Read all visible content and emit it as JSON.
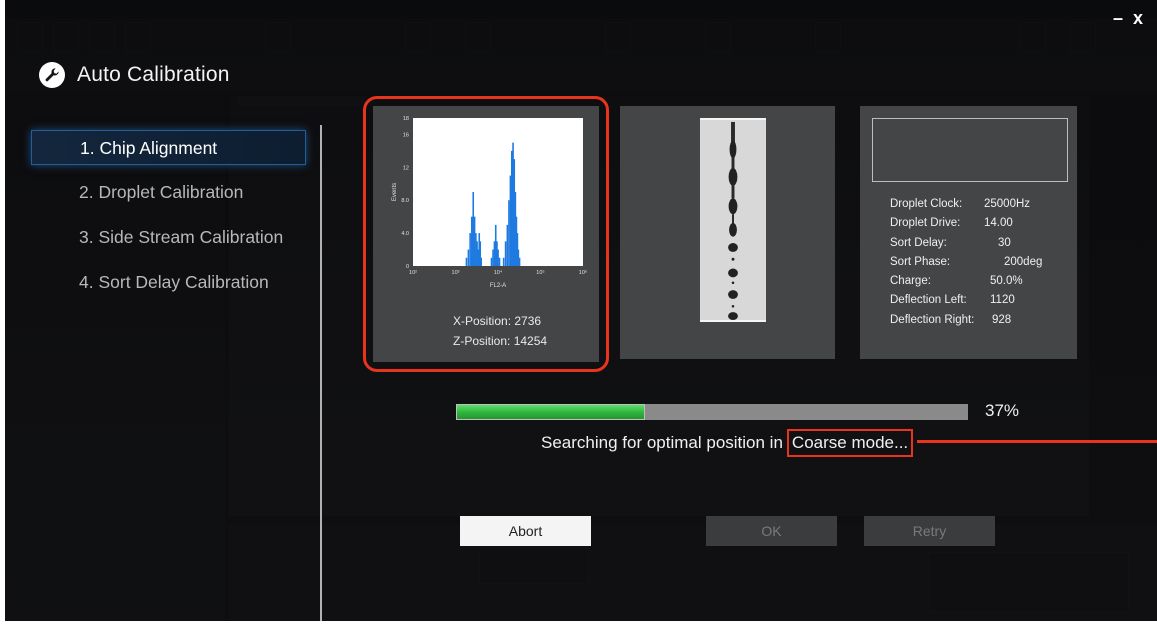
{
  "window": {
    "minimize_label": "–",
    "close_label": "x"
  },
  "dialog": {
    "title": "Auto Calibration"
  },
  "steps": [
    {
      "label": "1. Chip Alignment",
      "active": true
    },
    {
      "label": "2. Droplet Calibration",
      "active": false
    },
    {
      "label": "3. Side Stream Calibration",
      "active": false
    },
    {
      "label": "4. Sort Delay Calibration",
      "active": false
    }
  ],
  "chip_panel": {
    "x_position_label": "X-Position:",
    "x_position_value": "2736",
    "z_position_label": "Z-Position:",
    "z_position_value": "14254"
  },
  "chart_data": {
    "type": "bar",
    "title": "",
    "xlabel": "FL2-A",
    "ylabel": "Events",
    "x_scale": "log",
    "xlim": [
      100,
      1000000
    ],
    "ylim": [
      0,
      18
    ],
    "x_tick_labels": [
      "10²",
      "10³",
      "10⁴",
      "10⁵",
      "10⁶"
    ],
    "x_tick_values": [
      100,
      1000,
      10000,
      100000,
      1000000
    ],
    "y_tick_labels": [
      "0",
      "4.0",
      "8.0",
      "12",
      "16",
      "18"
    ],
    "y_tick_values": [
      0,
      4,
      8,
      12,
      16,
      18
    ],
    "color": "#1f7ae0",
    "series": [
      {
        "values": [
          [
            1800,
            1
          ],
          [
            2000,
            2
          ],
          [
            2200,
            4
          ],
          [
            2400,
            6
          ],
          [
            2600,
            9
          ],
          [
            2800,
            6
          ],
          [
            3000,
            4
          ],
          [
            3200,
            3
          ],
          [
            3400,
            2
          ],
          [
            3600,
            4
          ],
          [
            3800,
            3
          ],
          [
            4000,
            1
          ],
          [
            7000,
            1
          ],
          [
            7600,
            2
          ],
          [
            8200,
            3
          ],
          [
            8800,
            5
          ],
          [
            9400,
            3
          ],
          [
            10000,
            2
          ],
          [
            10800,
            1
          ],
          [
            13500,
            1
          ],
          [
            15000,
            3
          ],
          [
            16500,
            5
          ],
          [
            18000,
            8
          ],
          [
            19500,
            11
          ],
          [
            21000,
            14
          ],
          [
            22500,
            15
          ],
          [
            24000,
            13
          ],
          [
            25500,
            9
          ],
          [
            27000,
            6
          ],
          [
            28500,
            4
          ],
          [
            30000,
            2
          ],
          [
            32000,
            1
          ]
        ]
      }
    ]
  },
  "droplet_panel": {},
  "params_panel": {
    "rows": [
      {
        "label": "Droplet Clock:",
        "value": "25000Hz"
      },
      {
        "label": "Droplet Drive:",
        "value": "14.00"
      },
      {
        "label": "Sort Delay:",
        "value": "30"
      },
      {
        "label": "Sort Phase:",
        "value": "200deg"
      },
      {
        "label": "Charge:",
        "value": "50.0%"
      },
      {
        "label": "Deflection Left:",
        "value": "1120"
      },
      {
        "label": "Deflection Right:",
        "value": "928"
      }
    ]
  },
  "progress": {
    "value": 0.37,
    "label": "37%"
  },
  "status": {
    "text": "Searching for optimal position in",
    "mode": "Coarse mode..."
  },
  "buttons": {
    "abort": "Abort",
    "ok": "OK",
    "retry": "Retry"
  },
  "colors": {
    "accent_red": "#e8341c",
    "progress_green": "#2fb33e",
    "active_step_border": "#1e5f9c"
  },
  "icons": {
    "title_icon": "wrench-icon"
  }
}
